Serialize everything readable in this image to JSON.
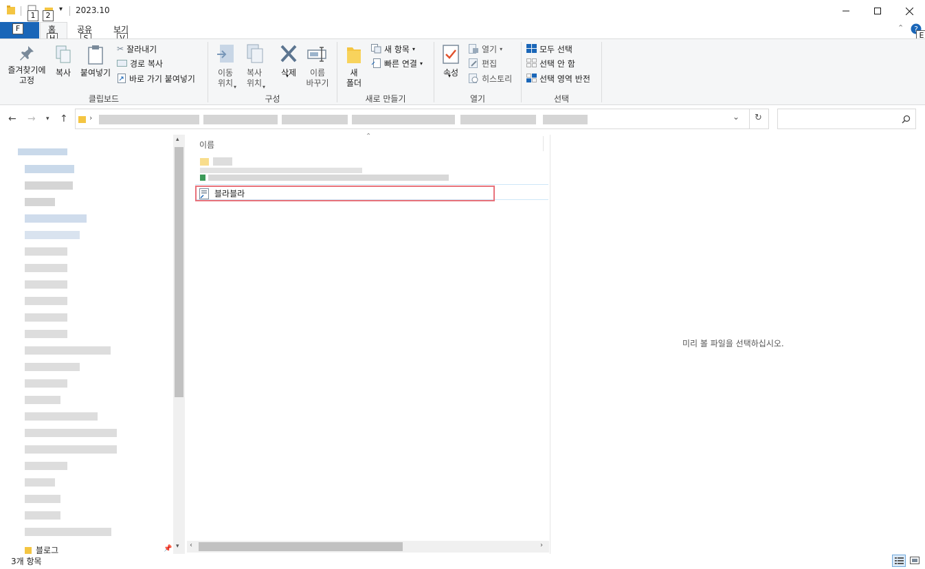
{
  "window": {
    "title": "2023.10",
    "keytips": {
      "qa1": "1",
      "qa2": "2",
      "file": "F",
      "home": "H",
      "share": "S",
      "view": "V",
      "help": "E"
    }
  },
  "tabs": {
    "home": "홈",
    "share": "공유",
    "view": "보기"
  },
  "ribbon": {
    "clipboard": {
      "label": "클립보드",
      "pin": "즐겨찾기에\n고정",
      "copy": "복사",
      "paste": "붙여넣기",
      "cut": "잘라내기",
      "copy_path": "경로 복사",
      "paste_shortcut": "바로 가기 붙여넣기"
    },
    "organize": {
      "label": "구성",
      "move_to": "이동\n위치",
      "copy_to": "복사\n위치",
      "delete": "삭제",
      "rename": "이름\n바꾸기"
    },
    "new": {
      "label": "새로 만들기",
      "new_folder": "새\n폴더",
      "new_item": "새 항목",
      "easy_access": "빠른 연결"
    },
    "open": {
      "label": "열기",
      "properties": "속성",
      "open": "열기",
      "edit": "편집",
      "history": "히스토리"
    },
    "select": {
      "label": "선택",
      "select_all": "모두 선택",
      "select_none": "선택 안 함",
      "invert": "선택 영역 반전"
    }
  },
  "filelist": {
    "column_name": "이름",
    "selected_item": "블라블라"
  },
  "navpane": {
    "last_item": "블로그"
  },
  "preview": {
    "message": "미리 볼 파일을 선택하십시오."
  },
  "status": {
    "count": "3개 항목"
  },
  "colors": {
    "file_tab": "#1a66b8",
    "highlight": "#e8717a",
    "folder": "#f4c542"
  }
}
